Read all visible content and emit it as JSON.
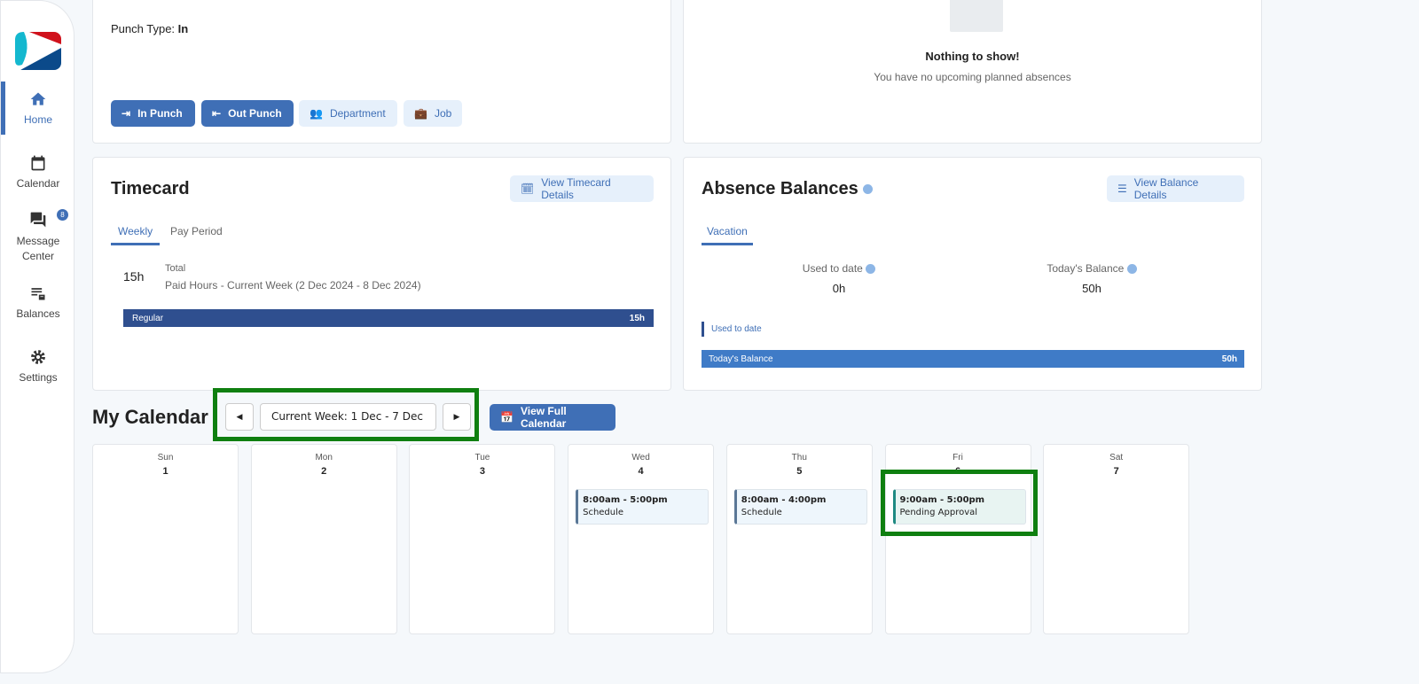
{
  "sidebar": {
    "items": [
      {
        "label": "Home",
        "icon": "home-icon"
      },
      {
        "label": "Calendar",
        "icon": "calendar-icon"
      },
      {
        "label": "Message Center",
        "icon": "chat-icon",
        "badge": "8"
      },
      {
        "label": "Balances",
        "icon": "balances-icon"
      },
      {
        "label": "Settings",
        "icon": "gear-icon"
      }
    ]
  },
  "punch": {
    "type_label": "Punch Type:",
    "type_value": "In",
    "buttons": {
      "in": "In Punch",
      "out": "Out Punch",
      "department": "Department",
      "job": "Job"
    }
  },
  "absences": {
    "empty_title": "Nothing to show!",
    "empty_text": "You have no upcoming planned absences"
  },
  "timecard": {
    "title": "Timecard",
    "details_button": "View Timecard Details",
    "tabs": [
      "Weekly",
      "Pay Period"
    ],
    "hours": "15h",
    "total_label": "Total",
    "period": "Paid Hours - Current Week (2 Dec 2024 - 8 Dec 2024)",
    "bar": {
      "label": "Regular",
      "value": "15h",
      "fraction": 1.0,
      "color": "#2f4f8f"
    }
  },
  "balances": {
    "title": "Absence Balances",
    "details_button": "View Balance Details",
    "tabs": [
      "Vacation"
    ],
    "used_label": "Used to date",
    "used_value": "0h",
    "balance_label": "Today's Balance",
    "balance_value": "50h",
    "bar_used_label": "Used to date",
    "bar_balance_label": "Today's Balance",
    "bar_balance_value": "50h",
    "color": "#3f7bc7"
  },
  "calendar": {
    "title": "My Calendar",
    "week_label": "Current Week: 1 Dec - 7 Dec",
    "full_button": "View Full Calendar",
    "days": [
      {
        "name": "Sun",
        "date": "1"
      },
      {
        "name": "Mon",
        "date": "2"
      },
      {
        "name": "Tue",
        "date": "3"
      },
      {
        "name": "Wed",
        "date": "4",
        "event": {
          "time": "8:00am - 5:00pm",
          "label": "Schedule"
        }
      },
      {
        "name": "Thu",
        "date": "5",
        "event": {
          "time": "8:00am - 4:00pm",
          "label": "Schedule"
        }
      },
      {
        "name": "Fri",
        "date": "6",
        "event": {
          "time": "9:00am - 5:00pm",
          "label": "Pending Approval"
        }
      },
      {
        "name": "Sat",
        "date": "7"
      }
    ]
  },
  "highlight_color": "#0f7f10"
}
